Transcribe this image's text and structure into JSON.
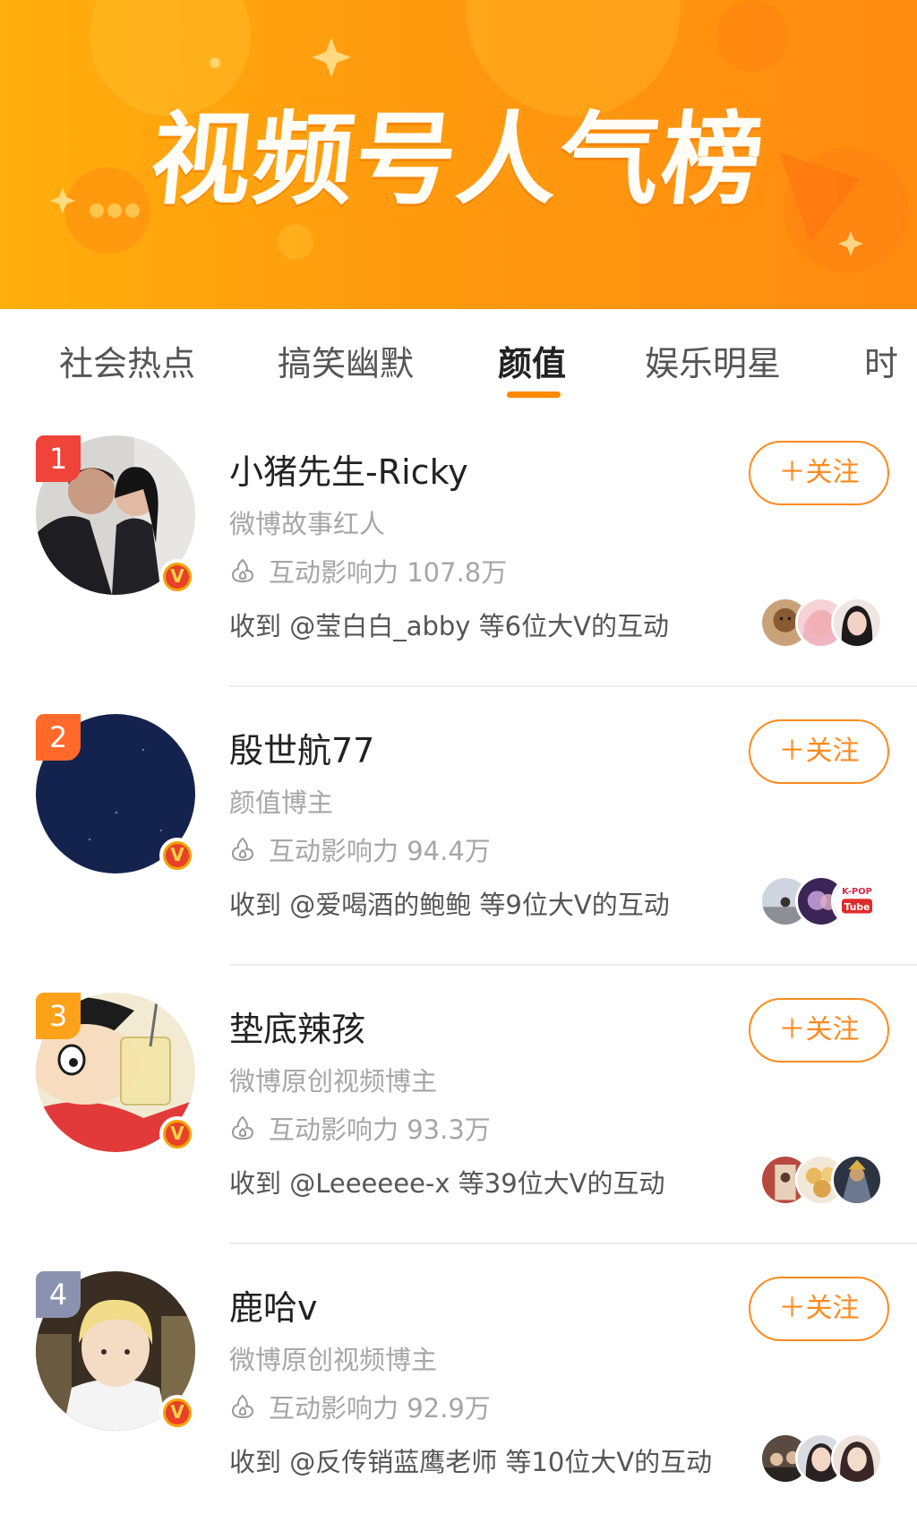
{
  "banner": {
    "title": "视频号人气榜"
  },
  "tabs": [
    {
      "label": "社会热点",
      "active": false
    },
    {
      "label": "搞笑幽默",
      "active": false
    },
    {
      "label": "颜值",
      "active": true
    },
    {
      "label": "娱乐明星",
      "active": false
    },
    {
      "label": "时",
      "active": false
    }
  ],
  "colors": {
    "accent": "#ff8a1e",
    "banner": "#ff9a0e",
    "rank1": "#f0433a",
    "rank2": "#ff6a2a",
    "rank3": "#ffa21a",
    "rank4": "#8b92b0"
  },
  "list": [
    {
      "rank": "1",
      "name": "小猪先生-Ricky",
      "description": "微博故事红人",
      "influence": "互动影响力 107.8万",
      "received": "收到 @莹白白_abby 等6位大V的互动",
      "follow_label": "＋关注",
      "verified_badge": "V",
      "mini_avatars": [
        "dog-photo",
        "pink-hair-girl",
        "girl-portrait"
      ]
    },
    {
      "rank": "2",
      "name": "殷世航77",
      "description": "颜值博主",
      "influence": "互动影响力 94.4万",
      "received": "收到 @爱喝酒的鲍鲍 等9位大V的互动",
      "follow_label": "＋关注",
      "verified_badge": "V",
      "mini_avatars": [
        "snowy-street-photo",
        "purple-portrait",
        "kpop-tube-logo"
      ],
      "kpop_logo": {
        "top": "K-POP",
        "bottom": "Tube"
      }
    },
    {
      "rank": "3",
      "name": "垫底辣孩",
      "description": "微博原创视频博主",
      "influence": "互动影响力 93.3万",
      "received": "收到 @Leeeeee-x 等39位大V的互动",
      "follow_label": "＋关注",
      "verified_badge": "V",
      "mini_avatars": [
        "doorway-photo",
        "food-photo",
        "game-character"
      ]
    },
    {
      "rank": "4",
      "name": "鹿哈v",
      "description": "微博原创视频博主",
      "influence": "互动影响力 92.9万",
      "received": "收到 @反传销蓝鹰老师 等10位大V的互动",
      "follow_label": "＋关注",
      "verified_badge": "V",
      "mini_avatars": [
        "crowd-photo",
        "girl-portrait-2",
        "girl-portrait-3"
      ]
    }
  ]
}
